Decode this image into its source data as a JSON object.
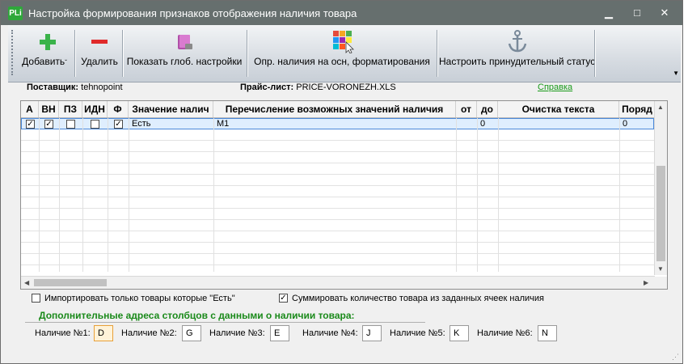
{
  "window": {
    "app_icon_text": "PLi",
    "title": "Настройка формирования признаков отображения наличия товара",
    "minimize_glyph": "▁",
    "maximize_glyph": "□",
    "close_glyph": "✕"
  },
  "toolbar": {
    "add_label": "Добавить",
    "delete_label": "Удалить",
    "show_global_label": "Показать глоб. настройки",
    "determine_label": "Опр. наличия на осн, форматирования",
    "force_status_label": "Настроить принудительный статус",
    "overflow_glyph": "▼"
  },
  "info": {
    "supplier_label": "Поставщик:",
    "supplier_value": "tehnopoint",
    "pricelist_label": "Прайс-лист:",
    "pricelist_value": "PRICE-VORONEZH.XLS",
    "help_link": "Справка"
  },
  "grid": {
    "columns": [
      "А",
      "ВН",
      "ПЗ",
      "ИДН",
      "Ф",
      "Значение налич",
      "Перечисление возможных значений наличия",
      "от",
      "до",
      "Очистка текста",
      "Поряд"
    ],
    "rows": [
      {
        "a": true,
        "vn": true,
        "pz": false,
        "idn": false,
        "f": true,
        "value": "Есть",
        "enum": "M1",
        "from": "",
        "to": "0",
        "clean": "",
        "order": "0"
      }
    ]
  },
  "options": {
    "import_only_label": "Импортировать только товары которые \"Есть\"",
    "import_only_checked": false,
    "sum_label": "Суммировать количество товара из заданных ячеек наличия",
    "sum_checked": true
  },
  "addresses": {
    "section_title": "Дополнительные адреса столбцов с данными о наличии товара:",
    "items": [
      {
        "label": "Наличие №1:",
        "value": "D"
      },
      {
        "label": "Наличие №2:",
        "value": "G"
      },
      {
        "label": "Наличие №3:",
        "value": "E"
      },
      {
        "label": "Наличие №4:",
        "value": "J"
      },
      {
        "label": "Наличие №5:",
        "value": "K"
      },
      {
        "label": "Наличие №6:",
        "value": "N"
      }
    ]
  }
}
